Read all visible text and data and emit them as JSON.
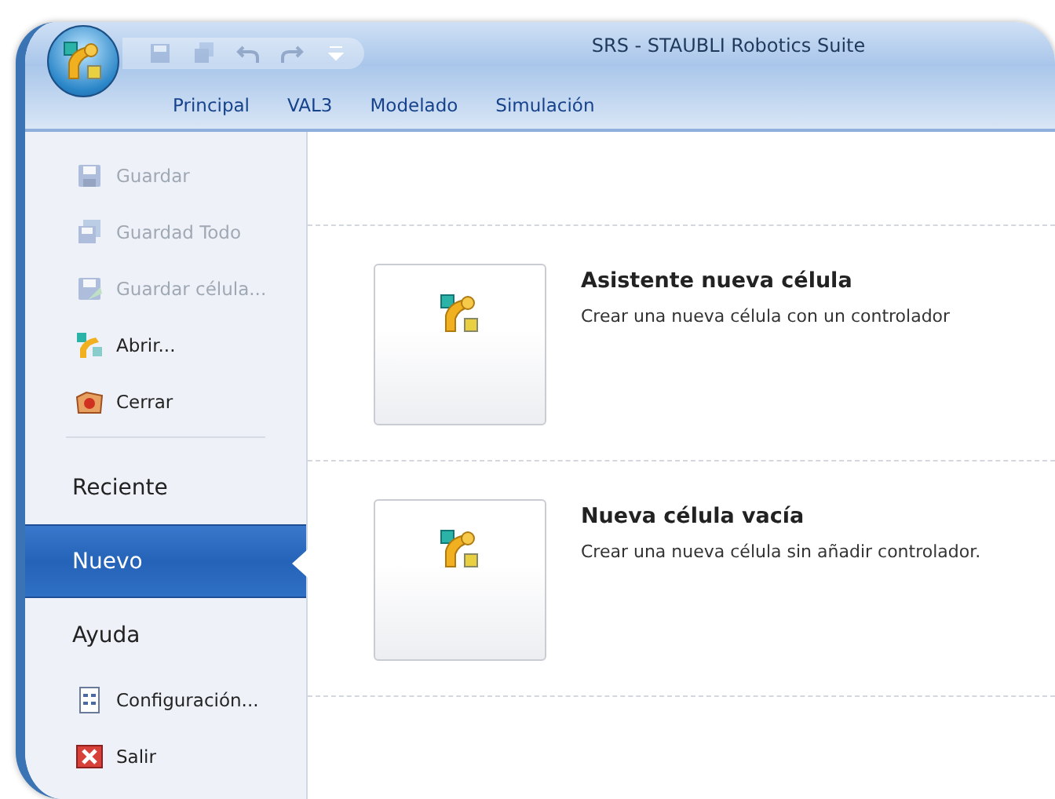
{
  "window": {
    "title": "SRS - STAUBLI Robotics Suite"
  },
  "quick_access": [
    {
      "kind": "save",
      "disabled": true
    },
    {
      "kind": "save-all",
      "disabled": true
    },
    {
      "kind": "undo",
      "disabled": true
    },
    {
      "kind": "redo",
      "disabled": true
    },
    {
      "kind": "dropdown",
      "disabled": false
    }
  ],
  "ribbon_tabs": [
    {
      "label": "Principal"
    },
    {
      "label": "VAL3"
    },
    {
      "label": "Modelado"
    },
    {
      "label": "Simulación"
    }
  ],
  "menu": [
    {
      "kind": "command",
      "label": "Guardar",
      "disabled": true
    },
    {
      "kind": "command",
      "label": "Guardad Todo",
      "disabled": true
    },
    {
      "kind": "command",
      "label": "Guardar célula...",
      "disabled": true
    },
    {
      "kind": "command",
      "label": "Abrir...",
      "disabled": false
    },
    {
      "kind": "command",
      "label": "Cerrar",
      "disabled": false
    },
    {
      "kind": "separator"
    },
    {
      "kind": "section",
      "label": "Reciente",
      "selected": false
    },
    {
      "kind": "section",
      "label": "Nuevo",
      "selected": true
    },
    {
      "kind": "section",
      "label": "Ayuda",
      "selected": false
    },
    {
      "kind": "command",
      "label": "Configuración...",
      "disabled": false
    },
    {
      "kind": "command",
      "label": "Salir",
      "disabled": false
    }
  ],
  "options": [
    {
      "title": "Asistente nueva célula",
      "description": "Crear una nueva célula con un controlador"
    },
    {
      "title": "Nueva célula vacía",
      "description": "Crear una nueva célula sin añadir controlador."
    }
  ]
}
